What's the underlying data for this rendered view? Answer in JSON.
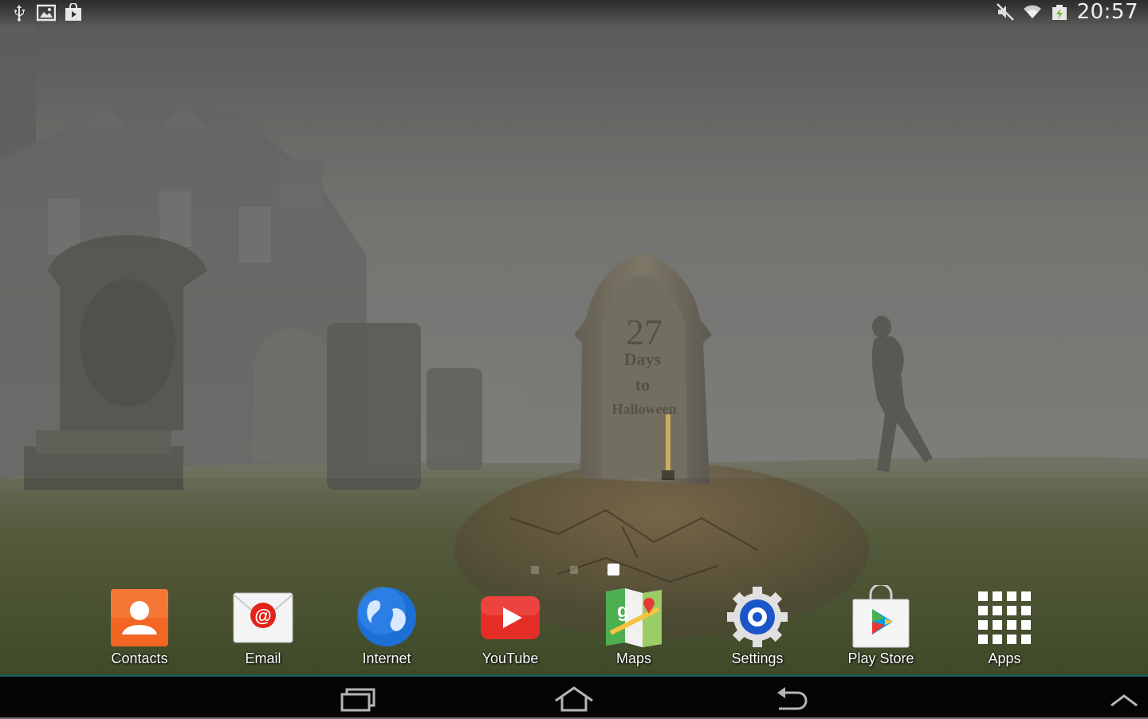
{
  "status_bar": {
    "time": "20:57",
    "left_icons": [
      "usb-icon",
      "picture-icon",
      "store-bag-icon"
    ],
    "right_icons": [
      "mute-icon",
      "wifi-icon",
      "battery-icon"
    ]
  },
  "wallpaper": {
    "tombstone_lines": [
      "27",
      "Days",
      "to",
      "Halloween"
    ]
  },
  "home": {
    "pages": 3,
    "current_page": 3
  },
  "dock": {
    "apps": [
      {
        "label": "Contacts",
        "icon": "contacts-icon",
        "color": "#f26522"
      },
      {
        "label": "Email",
        "icon": "email-icon",
        "color": "#e2231a"
      },
      {
        "label": "Internet",
        "icon": "internet-globe-icon",
        "color": "#1c6fd6"
      },
      {
        "label": "YouTube",
        "icon": "youtube-icon",
        "color": "#e52d27"
      },
      {
        "label": "Maps",
        "icon": "maps-icon",
        "color": "#4caf50"
      },
      {
        "label": "Settings",
        "icon": "settings-gear-icon",
        "color": "#1a56c9"
      },
      {
        "label": "Play Store",
        "icon": "play-store-icon",
        "color": "#00a0e0"
      },
      {
        "label": "Apps",
        "icon": "apps-grid-icon",
        "color": "#ffffff"
      }
    ]
  },
  "navbar": {
    "accent": "#1c5a5a",
    "buttons": [
      "recent-apps-icon",
      "home-icon",
      "back-icon",
      "expand-up-icon"
    ]
  }
}
